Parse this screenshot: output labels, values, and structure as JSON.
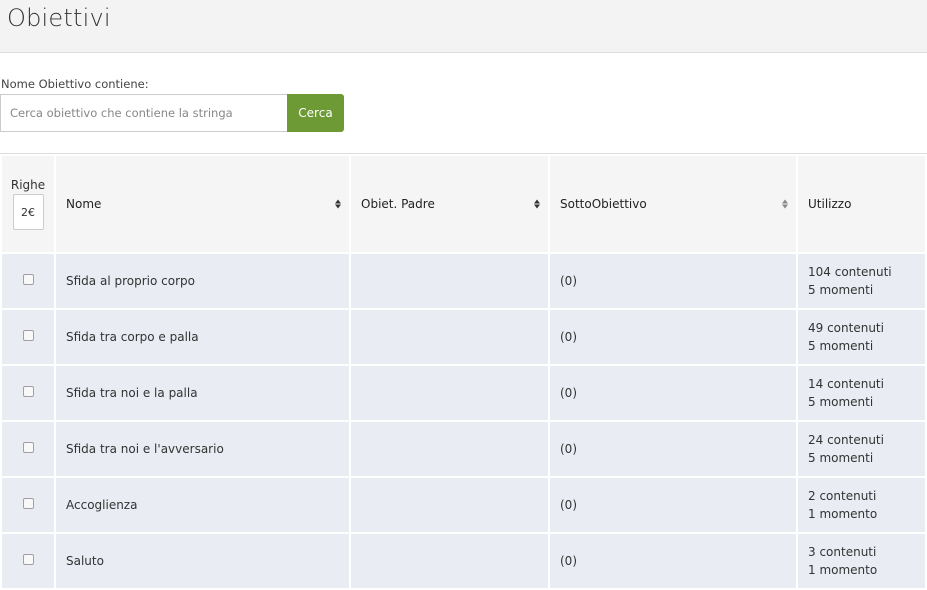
{
  "header": {
    "title": "Obiettivi"
  },
  "search": {
    "label": "Nome Obiettivo contiene:",
    "placeholder": "Cerca obiettivo che contiene la stringa",
    "button_label": "Cerca"
  },
  "table": {
    "rows_per_page": {
      "label": "Righe",
      "value": "2€"
    },
    "columns": {
      "nome": "Nome",
      "obiet_padre": "Obiet. Padre",
      "sotto_obiettivo": "SottoObiettivo",
      "utilizzo": "Utilizzo"
    },
    "rows": [
      {
        "nome": "Sfida al proprio corpo",
        "obiet_padre": "",
        "sotto_obiettivo": "(0)",
        "utilizzo_contenuti": "104 contenuti",
        "utilizzo_momenti": "5 momenti"
      },
      {
        "nome": "Sfida tra corpo e palla",
        "obiet_padre": "",
        "sotto_obiettivo": "(0)",
        "utilizzo_contenuti": "49 contenuti",
        "utilizzo_momenti": "5 momenti"
      },
      {
        "nome": "Sfida tra noi e la palla",
        "obiet_padre": "",
        "sotto_obiettivo": "(0)",
        "utilizzo_contenuti": "14 contenuti",
        "utilizzo_momenti": "5 momenti"
      },
      {
        "nome": "Sfida tra noi e l'avversario",
        "obiet_padre": "",
        "sotto_obiettivo": "(0)",
        "utilizzo_contenuti": "24 contenuti",
        "utilizzo_momenti": "5 momenti"
      },
      {
        "nome": "Accoglienza",
        "obiet_padre": "",
        "sotto_obiettivo": "(0)",
        "utilizzo_contenuti": "2 contenuti",
        "utilizzo_momenti": "1 momento"
      },
      {
        "nome": "Saluto",
        "obiet_padre": "",
        "sotto_obiettivo": "(0)",
        "utilizzo_contenuti": "3 contenuti",
        "utilizzo_momenti": "1 momento"
      }
    ]
  },
  "colors": {
    "header_bg": "#f3f3f3",
    "accent_button": "#6d9a35",
    "row_bg": "#e9ecf3",
    "header_cell_bg": "#f5f5f5"
  },
  "icons": {
    "sort": "sort-icon",
    "checkbox": "checkbox-icon",
    "dropdown": "chevron-down-icon"
  }
}
